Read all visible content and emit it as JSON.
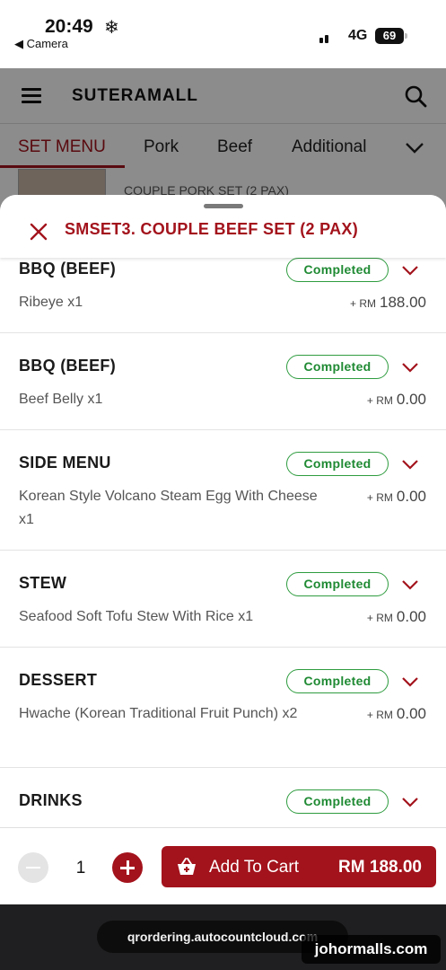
{
  "status_bar": {
    "time": "20:49",
    "weather_glyph": "❄",
    "back_app": "◀ Camera",
    "network": "4G",
    "battery": "69"
  },
  "header": {
    "brand": "SUTERAMALL",
    "menu_icon": "hamburger-icon",
    "search_icon": "search-icon"
  },
  "tabs": [
    {
      "label": "SET MENU",
      "active": true
    },
    {
      "label": "Pork",
      "active": false
    },
    {
      "label": "Beef",
      "active": false
    },
    {
      "label": "Additional",
      "active": false
    }
  ],
  "background_item": {
    "text": "COUPLE PORK SET (2 PAX)"
  },
  "sheet": {
    "title": "SMSET3. COUPLE BEEF SET (2 PAX)",
    "items": [
      {
        "title": "BBQ (BEEF)",
        "status": "Completed",
        "desc": "Ribeye x1",
        "price_prefix": "+ RM",
        "price": "188.00"
      },
      {
        "title": "BBQ (BEEF)",
        "status": "Completed",
        "desc": "Beef Belly x1",
        "price_prefix": "+ RM",
        "price": "0.00"
      },
      {
        "title": "SIDE MENU",
        "status": "Completed",
        "desc": "Korean Style Volcano Steam Egg With Cheese x1",
        "price_prefix": "+ RM",
        "price": "0.00"
      },
      {
        "title": "STEW",
        "status": "Completed",
        "desc": "Seafood Soft Tofu Stew With Rice x1",
        "price_prefix": "+ RM",
        "price": "0.00"
      },
      {
        "title": "DESSERT",
        "status": "Completed",
        "desc": "Hwache (Korean Traditional Fruit Punch) x2",
        "price_prefix": "+ RM",
        "price": "0.00"
      },
      {
        "title": "DRINKS",
        "status": "Completed",
        "desc": "",
        "price_prefix": "",
        "price": ""
      }
    ]
  },
  "footer": {
    "quantity": "1",
    "add_label": "Add To Cart",
    "total": "RM 188.00"
  },
  "browser": {
    "url": "qrordering.autocountcloud.com",
    "watermark": "johormalls.com"
  },
  "colors": {
    "accent": "#a3131c",
    "status_green": "#2e9c3f"
  }
}
